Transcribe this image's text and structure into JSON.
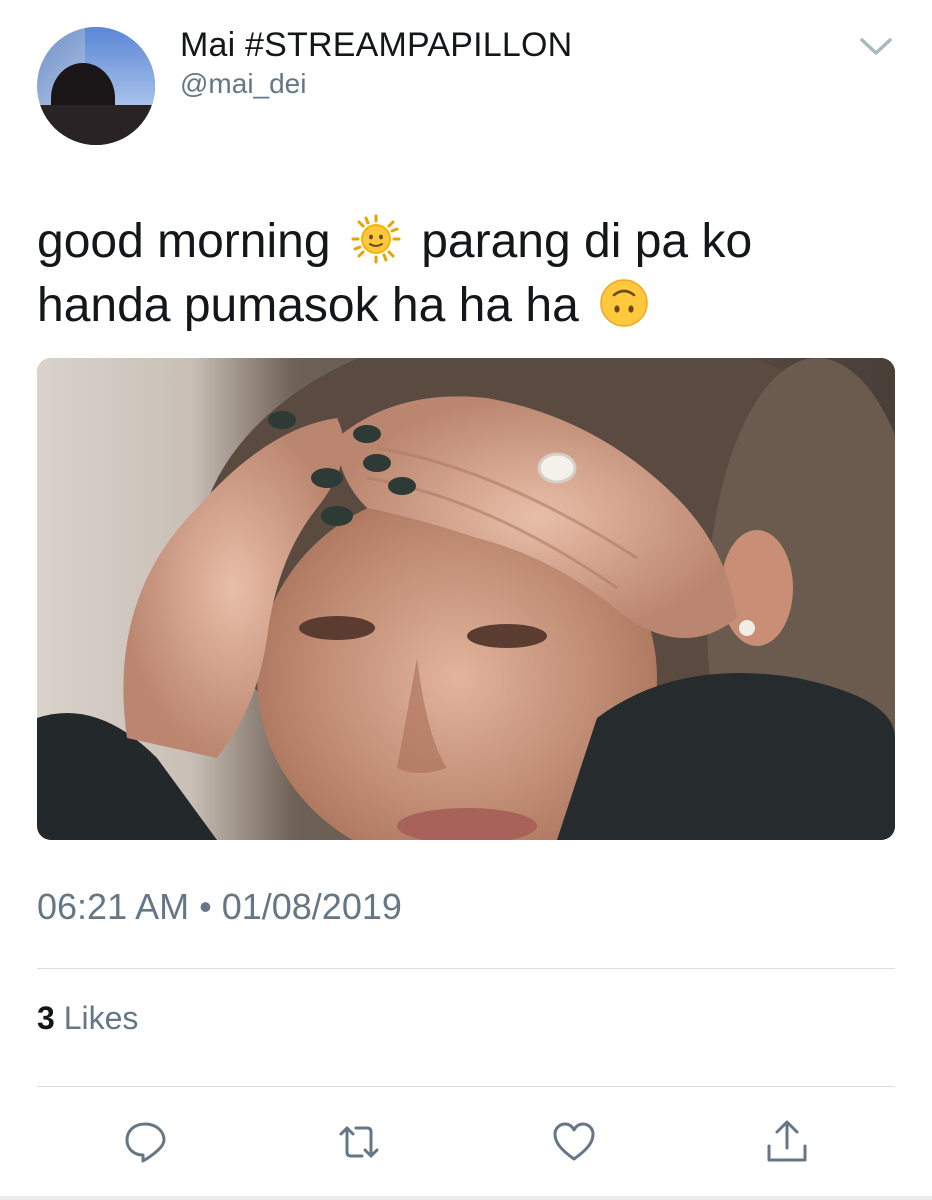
{
  "tweet": {
    "author": {
      "display_name": "Mai #STREAMPAPILLON",
      "handle": "@mai_dei",
      "avatar_icon": "profile-photo"
    },
    "text_line_1_part_1": "good morning",
    "emoji_1": "sun-with-face",
    "text_line_1_part_2": "parang di pa ko",
    "text_line_2": "handa pumasok ha ha ha",
    "emoji_2": "upside-down-face",
    "media": {
      "type": "photo",
      "icon": "photo-woman-hands-on-head"
    },
    "timestamp": "06:21 AM • 01/08/2019",
    "likes": {
      "count": "3",
      "label": "Likes"
    }
  },
  "actions": {
    "reply_icon": "reply-icon",
    "retweet_icon": "retweet-icon",
    "like_icon": "heart-icon",
    "share_icon": "share-icon"
  },
  "colors": {
    "text_primary": "#14171a",
    "text_secondary": "#657786",
    "divider": "#d8dde1"
  }
}
